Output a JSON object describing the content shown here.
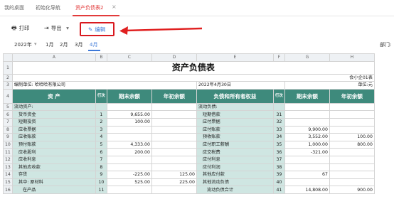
{
  "tabs": [
    {
      "label": "我的桌面"
    },
    {
      "label": "初始化导航"
    },
    {
      "label": "资产负债表2"
    }
  ],
  "toolbar": {
    "print_label": "打印",
    "export_label": "导出",
    "edit_label": "编辑"
  },
  "filter": {
    "year": "2022年",
    "months": [
      "1月",
      "2月",
      "3月",
      "4月"
    ],
    "active_month": "4月",
    "dept_label": "部门:"
  },
  "sheet": {
    "columns": [
      "A",
      "B",
      "C",
      "D",
      "E",
      "F",
      "G",
      "H"
    ],
    "title": "资产负债表",
    "form_no": "会小企01表",
    "company": "编制单位: 哈哈哈有限公司",
    "date": "2022年4月30日",
    "unit": "单位:元",
    "headers": {
      "asset": "资    产",
      "line_no": "行次",
      "end_balance": "期末余额",
      "begin_balance": "年初余额",
      "liab": "负债和所有者权益",
      "line_no2": "行次",
      "end_balance2": "期末余额",
      "begin_balance2": "年初余额"
    },
    "rows": [
      {
        "rn": "5",
        "a": "流动资产:",
        "b": "",
        "c": "",
        "d": "",
        "e": "流动负债:",
        "f": "",
        "g": "",
        "h": ""
      },
      {
        "rn": "6",
        "a": "货币资金",
        "b": "1",
        "c": "9,655.00",
        "d": "",
        "e": "短期借款",
        "f": "31",
        "g": "",
        "h": ""
      },
      {
        "rn": "7",
        "a": "短期投资",
        "b": "2",
        "c": "100.00",
        "d": "",
        "e": "应付票据",
        "f": "32",
        "g": "",
        "h": ""
      },
      {
        "rn": "8",
        "a": "应收票据",
        "b": "3",
        "c": "",
        "d": "",
        "e": "应付账款",
        "f": "33",
        "g": "9,900.00",
        "h": ""
      },
      {
        "rn": "9",
        "a": "应收账款",
        "b": "4",
        "c": "",
        "d": "",
        "e": "预收账款",
        "f": "34",
        "g": "3,552.00",
        "h": "100.00"
      },
      {
        "rn": "10",
        "a": "预付账款",
        "b": "5",
        "c": "4,333.00",
        "d": "",
        "e": "应付职工薪酬",
        "f": "35",
        "g": "1,000.00",
        "h": "800.00"
      },
      {
        "rn": "11",
        "a": "应收股利",
        "b": "6",
        "c": "200.00",
        "d": "",
        "e": "应交税费",
        "f": "36",
        "g": "-321.00",
        "h": ""
      },
      {
        "rn": "12",
        "a": "应收利息",
        "b": "7",
        "c": "",
        "d": "",
        "e": "应付利息",
        "f": "37",
        "g": "",
        "h": ""
      },
      {
        "rn": "13",
        "a": "其他应收款",
        "b": "8",
        "c": "",
        "d": "",
        "e": "应付利润",
        "f": "38",
        "g": "",
        "h": ""
      },
      {
        "rn": "14",
        "a": "存货",
        "b": "9",
        "c": "-225.00",
        "d": "125.00",
        "e": "其他应付款",
        "f": "39",
        "g": "67",
        "h": ""
      },
      {
        "rn": "15",
        "a": "其中:  原材料",
        "b": "10",
        "c": "525.00",
        "d": "225.00",
        "e": "其他流动负债",
        "f": "40",
        "g": "",
        "h": ""
      },
      {
        "rn": "16",
        "a": "在产品",
        "b": "11",
        "c": "",
        "d": "",
        "e": "流动负债合计",
        "f": "41",
        "g": "14,808.00",
        "h": "900.00"
      }
    ]
  },
  "colors": {
    "accent_red": "#e23b3b",
    "accent_blue": "#3c78d8",
    "header_teal": "#3e8a7c",
    "cell_teal": "#cfe6e2"
  }
}
